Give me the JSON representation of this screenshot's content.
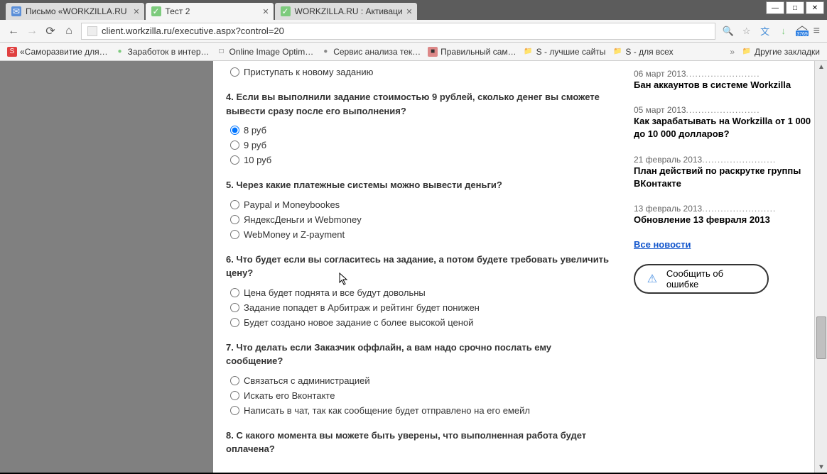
{
  "window": {
    "minimize": "—",
    "maximize": "□",
    "close": "✕"
  },
  "tabs": [
    {
      "title": "Письмо «WORKZILLA.RU",
      "favicon_bg": "#5b8fd8"
    },
    {
      "title": "Тест 2",
      "active": true,
      "favicon_bg": "#7dcb7d"
    },
    {
      "title": "WORKZILLA.RU : Активаци",
      "favicon_bg": "#7dcb7d"
    }
  ],
  "url": "client.workzilla.ru/executive.aspx?control=20",
  "toolbar_badge": "3769",
  "bookmarks": [
    {
      "label": "«Саморазвитие для…",
      "icon_bg": "#e04040",
      "icon_text": "S"
    },
    {
      "label": "Заработок в интер…",
      "icon_bg": "#7dcb7d",
      "icon_text": "●"
    },
    {
      "label": "Online Image Optim…",
      "icon_bg": "#555",
      "icon_text": "□"
    },
    {
      "label": "Сервис анализа тек…",
      "icon_bg": "#888",
      "icon_text": "●"
    },
    {
      "label": "Правильный сам…",
      "icon_bg": "#d88",
      "icon_text": "■"
    },
    {
      "label": "S - лучшие сайты",
      "folder": true
    },
    {
      "label": "S - для всех",
      "folder": true
    },
    {
      "label": "Другие закладки",
      "folder": true,
      "raquo": true
    }
  ],
  "questions": [
    {
      "text": "Приступать к новому заданию",
      "options": [],
      "is_trailing_option": true
    },
    {
      "text": "4. Если вы выполнили задание стоимостью 9 рублей, сколько денег вы сможете вывести сразу после его выполнения?",
      "options": [
        "8 руб",
        "9 руб",
        "10 руб"
      ],
      "selected": 0
    },
    {
      "text": "5. Через какие платежные системы можно вывести деньги?",
      "options": [
        "Paypal и Moneybookes",
        "ЯндексДеньги и Webmoney",
        "WebMoney и Z-payment"
      ]
    },
    {
      "text": "6. Что будет если вы согласитесь на задание, а потом будете требовать увеличить цену?",
      "options": [
        "Цена будет поднята и все будут довольны",
        "Задание попадет в Арбитраж и рейтинг будет понижен",
        "Будет создано новое задание с более высокой ценой"
      ]
    },
    {
      "text": "7. Что делать если Заказчик оффлайн, а вам надо срочно послать ему сообщение?",
      "options": [
        "Связаться с администрацией",
        "Искать его Вконтакте",
        "Написать в чат, так как сообщение будет отправлено на его емейл"
      ]
    },
    {
      "text": "8. С какого момента вы можете быть уверены, что выполненная работа будет оплачена?",
      "options": []
    }
  ],
  "news": [
    {
      "date": "06 март 2013",
      "title": "Бан аккаунтов в системе Workzilla"
    },
    {
      "date": "05 март 2013",
      "title": "Как зарабатывать на Workzilla от 1 000 до 10 000 долларов?"
    },
    {
      "date": "21 февраль 2013",
      "title": "План действий по раскрутке группы ВКонтакте"
    },
    {
      "date": "13 февраль 2013",
      "title": "Обновление 13 февраля 2013"
    }
  ],
  "all_news": "Все новости",
  "report_error": "Сообщить об ошибке"
}
